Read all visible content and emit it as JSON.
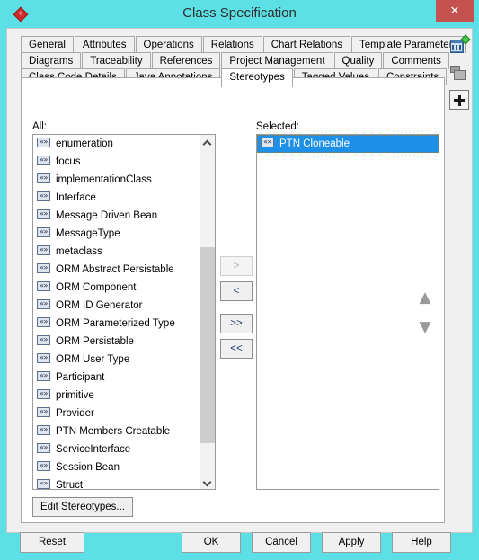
{
  "window": {
    "title": "Class Specification",
    "app_icon": "red-diamond-icon",
    "close_label": "✕",
    "titlebar_color": "#5ce0e6",
    "close_button_color": "#c4504f"
  },
  "tabs": {
    "rows": [
      [
        {
          "label": "General",
          "active": false
        },
        {
          "label": "Attributes",
          "active": false
        },
        {
          "label": "Operations",
          "active": false
        },
        {
          "label": "Relations",
          "active": false
        },
        {
          "label": "Chart Relations",
          "active": false
        },
        {
          "label": "Template Parameters",
          "active": false
        }
      ],
      [
        {
          "label": "Diagrams",
          "active": false
        },
        {
          "label": "Traceability",
          "active": false
        },
        {
          "label": "References",
          "active": false
        },
        {
          "label": "Project Management",
          "active": false
        },
        {
          "label": "Quality",
          "active": false
        },
        {
          "label": "Comments",
          "active": false
        }
      ],
      [
        {
          "label": "Class Code Details",
          "active": false
        },
        {
          "label": "Java Annotations",
          "active": false
        },
        {
          "label": "Stereotypes",
          "active": true
        },
        {
          "label": "Tagged Values",
          "active": false
        },
        {
          "label": "Constraints",
          "active": false
        }
      ]
    ]
  },
  "side_toolbar": {
    "items": [
      {
        "icon": "chart-add-icon"
      },
      {
        "icon": "copy-icon"
      },
      {
        "icon": "plus-icon"
      }
    ]
  },
  "panel": {
    "all_label": "All:",
    "selected_label": "Selected:",
    "all_items": [
      "enumeration",
      "focus",
      "implementationClass",
      "Interface",
      "Message Driven Bean",
      "MessageType",
      "metaclass",
      "ORM Abstract Persistable",
      "ORM Component",
      "ORM ID Generator",
      "ORM Parameterized Type",
      "ORM Persistable",
      "ORM User Type",
      "Participant",
      "primitive",
      "Provider",
      "PTN Members Creatable",
      "ServiceInterface",
      "Session Bean",
      "Struct"
    ],
    "selected_items": [
      "PTN Cloneable"
    ],
    "selection_highlight_color": "#1e90e8"
  },
  "transfer_buttons": [
    {
      "label": ">",
      "name": "move-right-button",
      "disabled": true
    },
    {
      "label": "<",
      "name": "move-left-button",
      "disabled": false
    },
    {
      "label": ">>",
      "name": "move-all-right-button",
      "disabled": false
    },
    {
      "label": "<<",
      "name": "move-all-left-button",
      "disabled": false
    }
  ],
  "order_buttons": [
    {
      "icon": "chevron-up-icon",
      "glyph": "▲"
    },
    {
      "icon": "chevron-down-icon",
      "glyph": "▼"
    }
  ],
  "edit_stereotypes_label": "Edit Stereotypes...",
  "footer": {
    "reset": "Reset",
    "ok": "OK",
    "cancel": "Cancel",
    "apply": "Apply",
    "help": "Help"
  }
}
